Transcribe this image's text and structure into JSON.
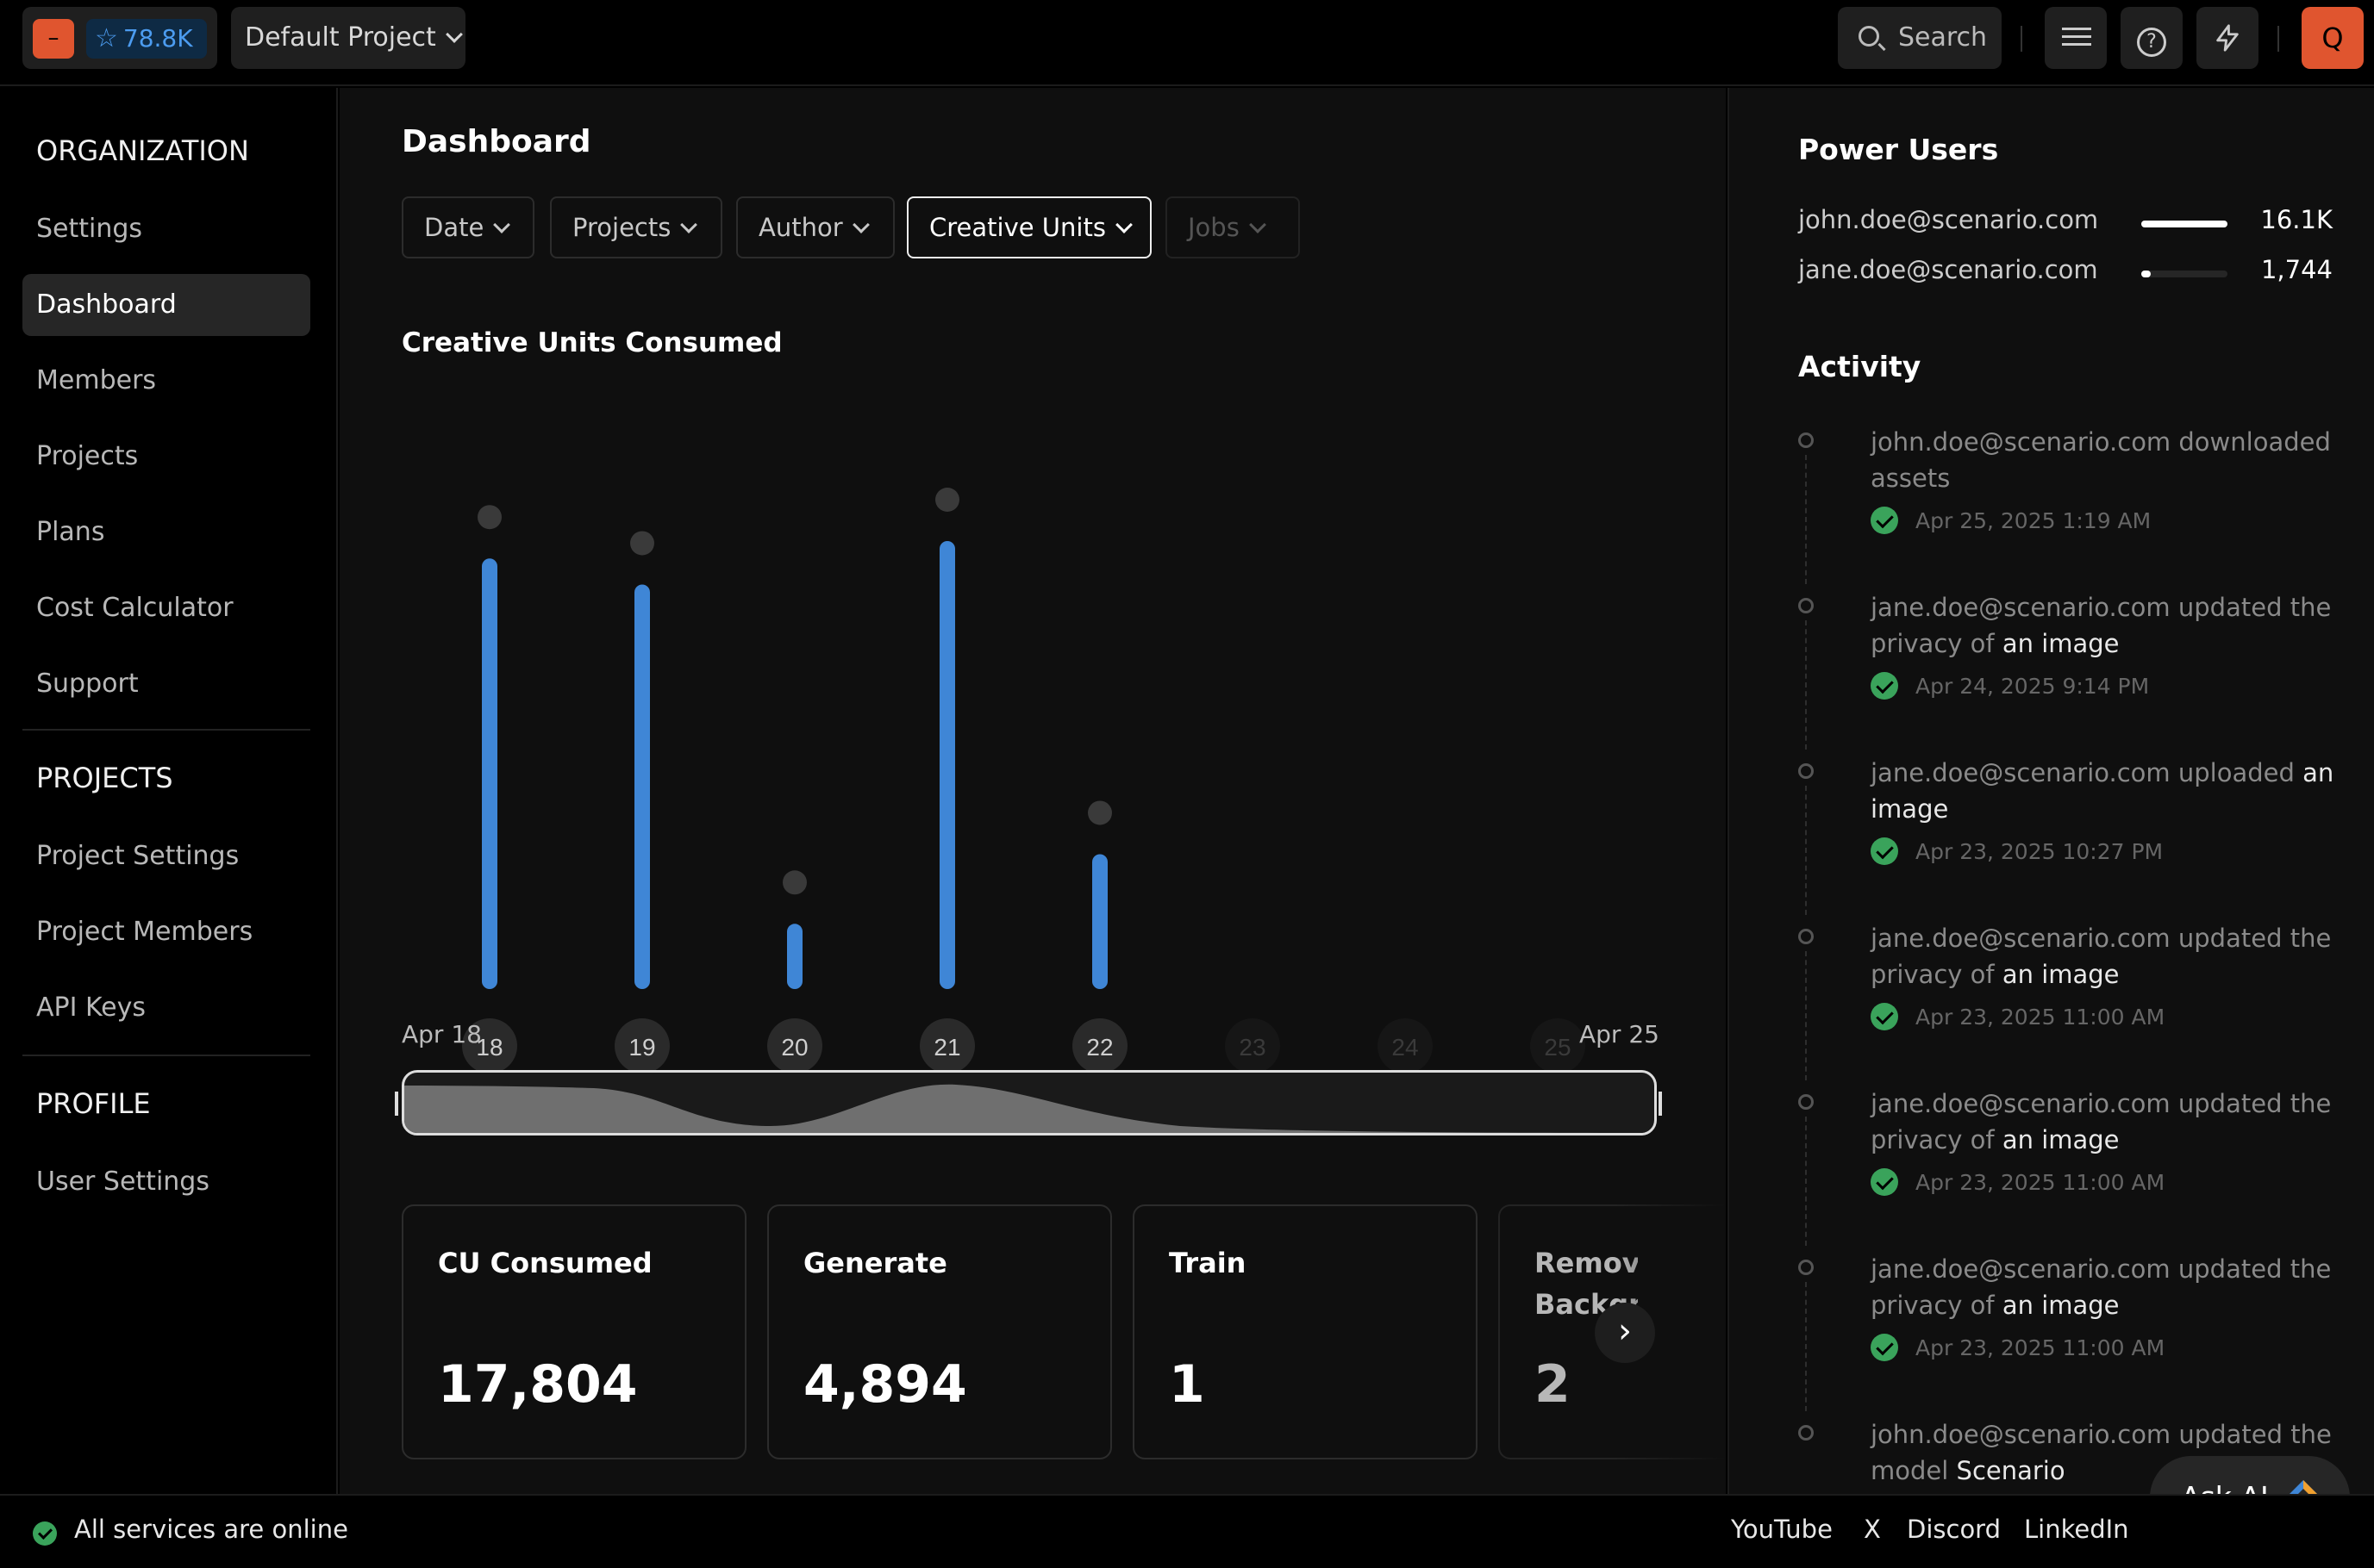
{
  "topbar": {
    "stars": "78.8K",
    "project": "Default Project",
    "search_label": "Search",
    "avatar_letter": "Q",
    "logo_glyph": "–"
  },
  "sidebar": {
    "org_title": "ORGANIZATION",
    "org_items": [
      {
        "label": "Settings",
        "active": false
      },
      {
        "label": "Dashboard",
        "active": true
      },
      {
        "label": "Members",
        "active": false
      },
      {
        "label": "Projects",
        "active": false
      },
      {
        "label": "Plans",
        "active": false
      },
      {
        "label": "Cost Calculator",
        "active": false
      },
      {
        "label": "Support",
        "active": false
      }
    ],
    "projects_title": "PROJECTS",
    "project_items": [
      {
        "label": "Project Settings"
      },
      {
        "label": "Project Members"
      },
      {
        "label": "API Keys"
      }
    ],
    "profile_title": "PROFILE",
    "profile_items": [
      {
        "label": "User Settings"
      }
    ]
  },
  "main": {
    "title": "Dashboard",
    "filters": [
      {
        "label": "Date",
        "state": "normal"
      },
      {
        "label": "Projects",
        "state": "normal"
      },
      {
        "label": "Author",
        "state": "normal"
      },
      {
        "label": "Creative Units",
        "state": "active"
      },
      {
        "label": "Jobs",
        "state": "disabled"
      }
    ],
    "chart_title": "Creative Units Consumed",
    "range_start": "Apr 18",
    "range_end": "Apr 25",
    "cards": [
      {
        "title": "CU Consumed",
        "value": "17,804"
      },
      {
        "title": "Generate",
        "value": "4,894"
      },
      {
        "title": "Train",
        "value": "1"
      },
      {
        "title": "Remove Background",
        "value": "2"
      }
    ]
  },
  "chart_data": {
    "type": "bar",
    "title": "Creative Units Consumed",
    "categories": [
      "18",
      "19",
      "20",
      "21",
      "22",
      "23",
      "24",
      "25"
    ],
    "values": [
      4950,
      4650,
      750,
      5150,
      1550,
      0,
      0,
      0
    ],
    "xlabel": "",
    "ylabel": "",
    "bar_color": "#3f86d6",
    "active_label_color": "#2a2a2a",
    "inactive_label_color": "#161616",
    "grid": false,
    "legend": "none"
  },
  "right": {
    "power_title": "Power Users",
    "power_users": [
      {
        "email": "john.doe@scenario.com",
        "value": "16.1K",
        "share": 1.0
      },
      {
        "email": "jane.doe@scenario.com",
        "value": "1,744",
        "share": 0.11
      }
    ],
    "activity_title": "Activity",
    "activity": [
      {
        "pre": "john.doe@scenario.com downloaded assets",
        "obj": "",
        "time": "Apr 25, 2025 1:19 AM"
      },
      {
        "pre": "jane.doe@scenario.com updated the privacy of ",
        "obj": "an image",
        "time": "Apr 24, 2025 9:14 PM"
      },
      {
        "pre": "jane.doe@scenario.com uploaded ",
        "obj": "an image",
        "time": "Apr 23, 2025 10:27 PM"
      },
      {
        "pre": "jane.doe@scenario.com updated the privacy of ",
        "obj": "an image",
        "time": "Apr 23, 2025 11:00 AM"
      },
      {
        "pre": "jane.doe@scenario.com updated the privacy of ",
        "obj": "an image",
        "time": "Apr 23, 2025 11:00 AM"
      },
      {
        "pre": "jane.doe@scenario.com updated the privacy of ",
        "obj": "an image",
        "time": "Apr 23, 2025 11:00 AM"
      },
      {
        "pre": "john.doe@scenario.com updated the model ",
        "obj": "Scenario",
        "time": ""
      }
    ],
    "ask_ai": "Ask AI"
  },
  "footer": {
    "status": "All services are online",
    "links": [
      "YouTube",
      "X",
      "Discord",
      "LinkedIn"
    ]
  },
  "colors": {
    "accent": "#e0552f",
    "star_blue": "#4c9cf0",
    "success": "#3aa35b"
  }
}
